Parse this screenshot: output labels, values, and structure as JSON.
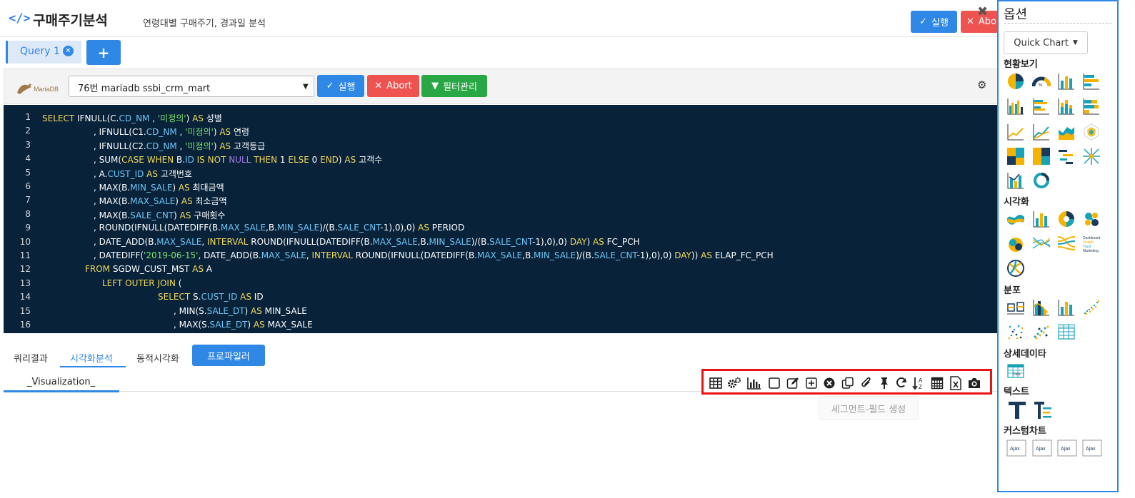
{
  "header": {
    "title": "구매주기분석",
    "subtitle": "연령대별 구매주기, 경과일 분석",
    "run_label": "실행",
    "abort_label": "Abo"
  },
  "query_tabs": {
    "tab1_label": "Query 1",
    "add_label": "+"
  },
  "toolbar": {
    "logo_text": "MariaDB",
    "db_select_value": "76번 mariadb ssbi_crm_mart",
    "run_label": "실행",
    "abort_label": "Abort",
    "filter_label": "필터관리"
  },
  "editor": {
    "line_numbers": [
      "1",
      "2",
      "3",
      "4",
      "5",
      "6",
      "7",
      "8",
      "9",
      "10",
      "11",
      "12",
      "13",
      "14",
      "15",
      "16"
    ],
    "lines": [
      "SELECT IFNULL(C.CD_NM , '미정의') AS 성별",
      ", IFNULL(C1.CD_NM , '미정의') AS 연령",
      ", IFNULL(C2.CD_NM , '미정의') AS 고객등급",
      ", SUM(CASE WHEN B.ID IS NOT NULL THEN 1 ELSE 0 END) AS 고객수",
      ", A.CUST_ID AS 고객번호",
      ", MAX(B.MIN_SALE) AS 최대금액",
      ", MAX(B.MAX_SALE) AS 최소금액",
      ", MAX(B.SALE_CNT) AS 구매횟수",
      ", ROUND(IFNULL(DATEDIFF(B.MAX_SALE,B.MIN_SALE)/(B.SALE_CNT-1),0),0) AS PERIOD",
      ", DATE_ADD(B.MAX_SALE, INTERVAL ROUND(IFNULL(DATEDIFF(B.MAX_SALE,B.MIN_SALE)/(B.SALE_CNT-1),0),0) DAY) AS FC_PCH",
      ", DATEDIFF('2019-06-15', DATE_ADD(B.MAX_SALE, INTERVAL ROUND(IFNULL(DATEDIFF(B.MAX_SALE,B.MIN_SALE)/(B.SALE_CNT-1),0),0) DAY)) AS ELAP_FC_PCH",
      "FROM SGDW_CUST_MST AS A",
      "LEFT OUTER JOIN (",
      "SELECT S.CUST_ID AS ID",
      ", MIN(S.SALE_DT) AS MIN_SALE",
      ", MAX(S.SALE_DT) AS MAX_SALE"
    ]
  },
  "result_tabs": {
    "tab1": "쿼리결과",
    "tab2": "시각화분석",
    "tab3": "동적시각화",
    "profiler": "프로파일러",
    "viz_tab": "_Visualization_"
  },
  "viz_toolbar": {
    "tooltip": "세그먼트-필드 생성",
    "icons": [
      "table-icon",
      "cogs-icon",
      "bar-chart-icon",
      "square-icon",
      "edit-icon",
      "plus-square-icon",
      "close-circle-icon",
      "copy-icon",
      "paperclip-icon",
      "pin-icon",
      "refresh-icon",
      "sort-az-icon",
      "calculator-icon",
      "excel-icon",
      "camera-icon"
    ]
  },
  "options_panel": {
    "title": "옵션",
    "quick_chart_label": "Quick Chart",
    "sections": {
      "status": "현황보기",
      "visual": "시각화",
      "distribution": "분포",
      "detail": "상세데이타",
      "text": "텍스트",
      "custom": "커스텀차트"
    },
    "custom_icon_label": "Ajax",
    "detail_icon_label": "Data",
    "dashboard_icon_label": "Dashboard Insight Trust Marketing"
  },
  "colors": {
    "accent": "#2f87e6",
    "danger": "#ef5350",
    "success": "#29a745",
    "editor_bg": "#08223a",
    "chart_teal": "#17a2b8",
    "chart_yellow": "#f5b300",
    "chart_navy": "#1a3a5c"
  }
}
